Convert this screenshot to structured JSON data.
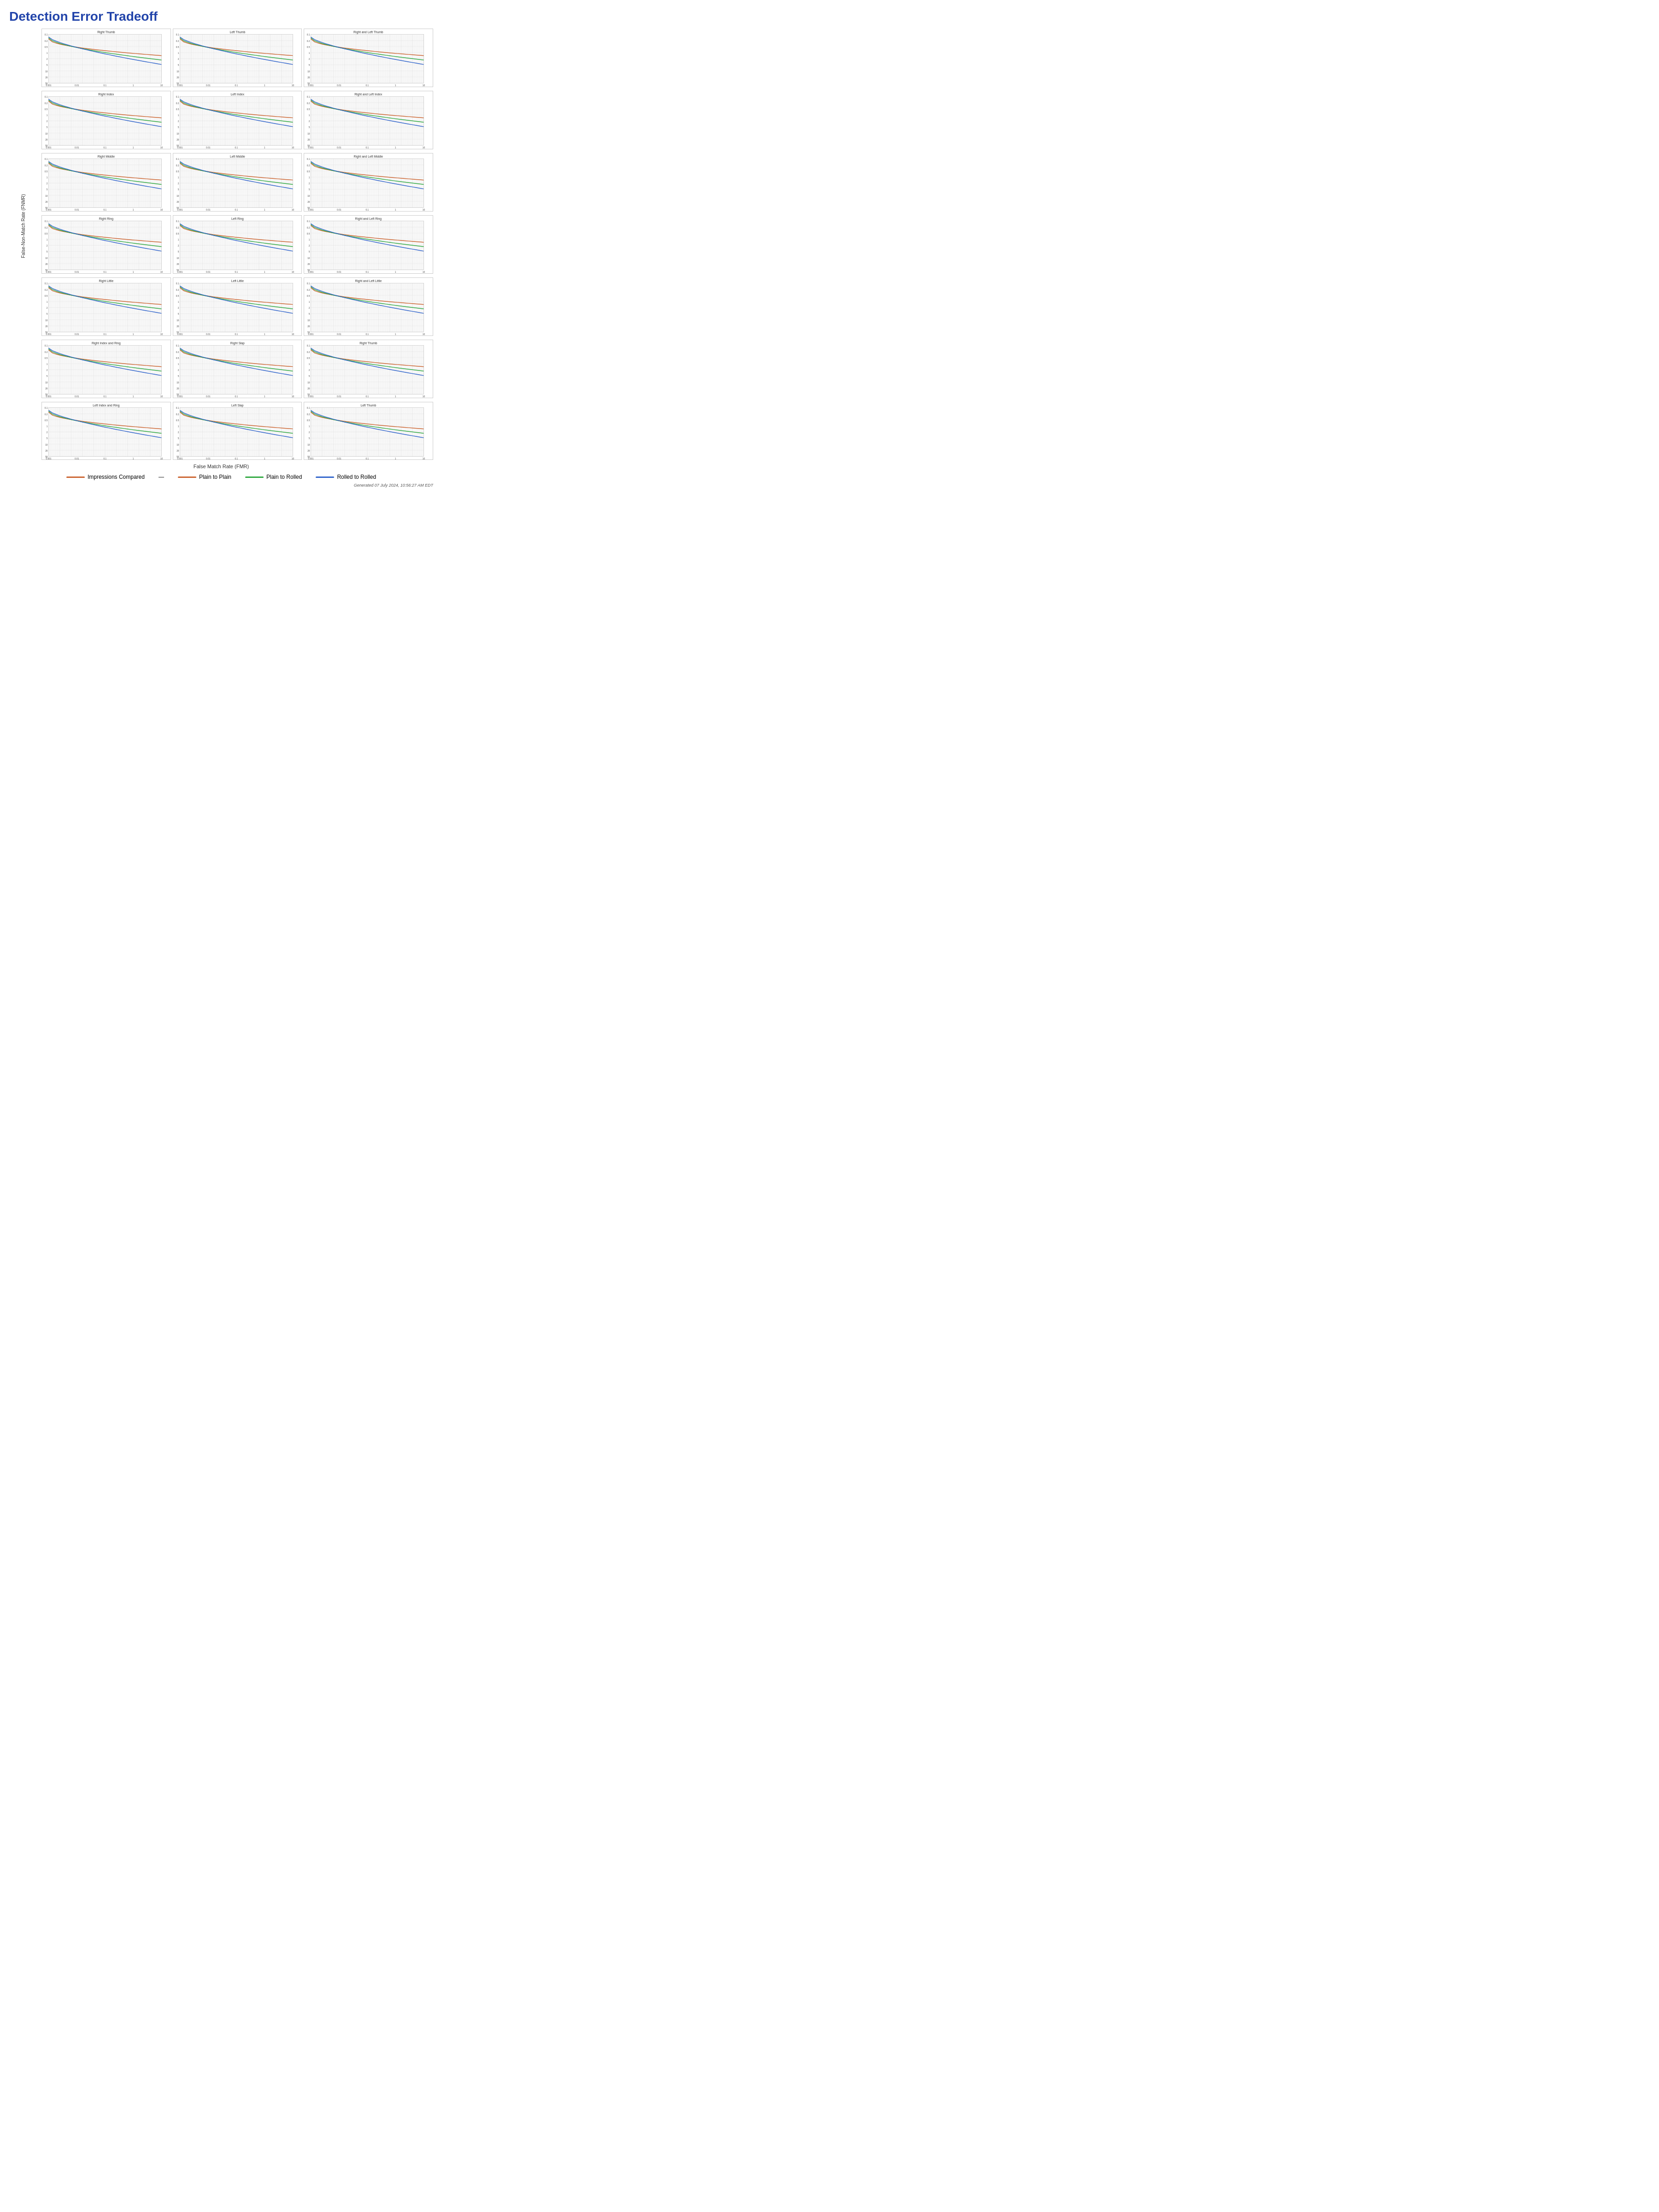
{
  "title": "Detection Error Tradeoff",
  "yAxisLabel": "False-​Non-​Match Rate (FNMR)",
  "xAxisLabel": "False Match Rate (FMR)",
  "legend": {
    "impressionsCompared": "Impressions Compared",
    "plainToPlain": "Plain to Plain",
    "plainToRolled": "Plain to Rolled",
    "rolledToRolled": "Rolled to Rolled",
    "colors": {
      "impressionsCompared": "#cc6633",
      "plainToPlain": "#cc6633",
      "plainToRolled": "#33aa44",
      "rolledToRolled": "#3366cc"
    }
  },
  "footer": "Generated 07 July 2024, 10:56:27 AM EDT",
  "rows": [
    {
      "charts": [
        {
          "title": "Right Thumb",
          "id": "r0c0"
        },
        {
          "title": "Left Thumb",
          "id": "r0c1"
        },
        {
          "title": "Right and Left Thumb",
          "id": "r0c2"
        }
      ]
    },
    {
      "charts": [
        {
          "title": "Right Index",
          "id": "r1c0"
        },
        {
          "title": "Left Index",
          "id": "r1c1"
        },
        {
          "title": "Right and Left Index",
          "id": "r1c2"
        }
      ]
    },
    {
      "charts": [
        {
          "title": "Right Middle",
          "id": "r2c0"
        },
        {
          "title": "Left Middle",
          "id": "r2c1"
        },
        {
          "title": "Right and Left Middle",
          "id": "r2c2"
        }
      ]
    },
    {
      "charts": [
        {
          "title": "Right Ring",
          "id": "r3c0"
        },
        {
          "title": "Left Ring",
          "id": "r3c1"
        },
        {
          "title": "Right and Left Ring",
          "id": "r3c2"
        }
      ]
    },
    {
      "charts": [
        {
          "title": "Right Little",
          "id": "r4c0"
        },
        {
          "title": "Left Little",
          "id": "r4c1"
        },
        {
          "title": "Right and Left Little",
          "id": "r4c2"
        }
      ]
    },
    {
      "charts": [
        {
          "title": "Right Index and Ring",
          "id": "r5c0"
        },
        {
          "title": "Right Slap",
          "id": "r5c1"
        },
        {
          "title": "Right Thumb",
          "id": "r5c2"
        }
      ]
    },
    {
      "charts": [
        {
          "title": "Left Index and Ring",
          "id": "r6c0"
        },
        {
          "title": "Left Slap",
          "id": "r6c1"
        },
        {
          "title": "Left Thumb",
          "id": "r6c2"
        }
      ]
    }
  ]
}
